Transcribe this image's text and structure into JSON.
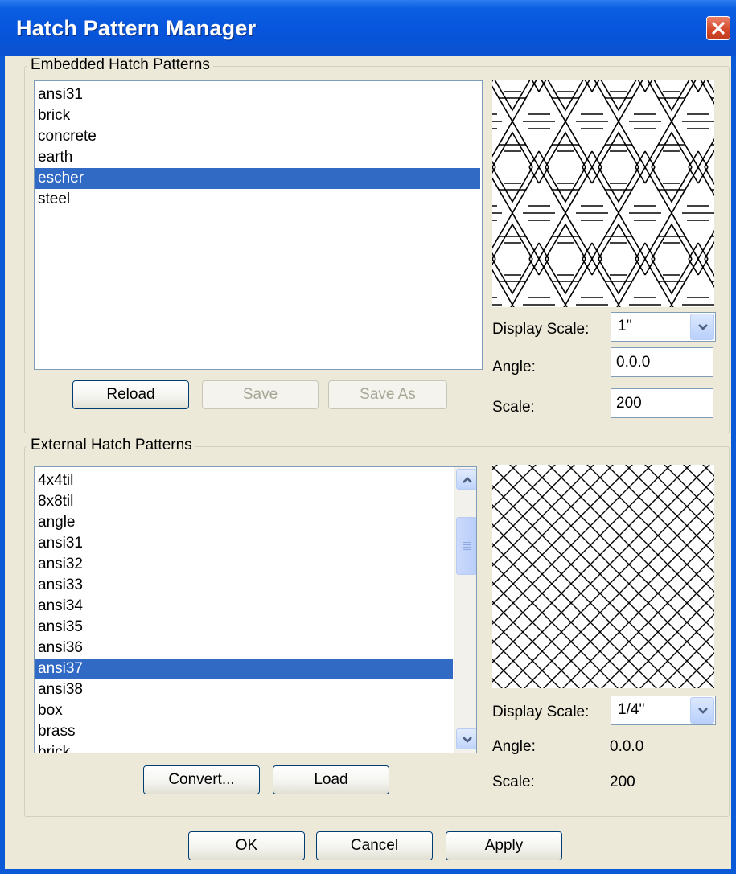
{
  "window": {
    "title": "Hatch Pattern Manager",
    "close_icon": "close-icon"
  },
  "embedded": {
    "group_label": "Embedded Hatch Patterns",
    "items": [
      "ansi31",
      "brick",
      "concrete",
      "earth",
      "escher",
      "steel"
    ],
    "selected_index": 4,
    "buttons": {
      "reload": "Reload",
      "save": "Save",
      "save_as": "Save As"
    },
    "display_scale_label": "Display Scale:",
    "display_scale_value": "1''",
    "angle_label": "Angle:",
    "angle_value": "0.0.0",
    "scale_label": "Scale:",
    "scale_value": "200"
  },
  "external": {
    "group_label": "External Hatch Patterns",
    "items": [
      "4x4til",
      "8x8til",
      "angle",
      "ansi31",
      "ansi32",
      "ansi33",
      "ansi34",
      "ansi35",
      "ansi36",
      "ansi37",
      "ansi38",
      "box",
      "brass",
      "brick"
    ],
    "selected_index": 9,
    "buttons": {
      "convert": "Convert...",
      "load": "Load"
    },
    "display_scale_label": "Display Scale:",
    "display_scale_value": "1/4''",
    "angle_label": "Angle:",
    "angle_value": "0.0.0",
    "scale_label": "Scale:",
    "scale_value": "200"
  },
  "footer": {
    "ok": "OK",
    "cancel": "Cancel",
    "apply": "Apply"
  },
  "colors": {
    "titlebar": "#0a5ad8",
    "selection": "#316ac5",
    "dialog_bg": "#ece9d8"
  }
}
